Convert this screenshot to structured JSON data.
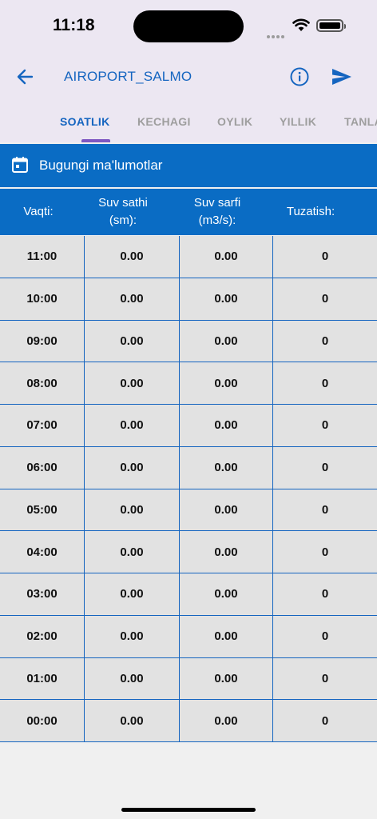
{
  "status": {
    "time": "11:18"
  },
  "header": {
    "title": "AIROPORT_SALMO"
  },
  "icons": {
    "back": "arrow-left-icon",
    "info": "info-icon",
    "send": "send-icon",
    "calendar": "calendar-icon"
  },
  "tabs": [
    {
      "label": "SOATLIK",
      "active": true
    },
    {
      "label": "KECHAGI",
      "active": false
    },
    {
      "label": "OYLIK",
      "active": false
    },
    {
      "label": "YILLIK",
      "active": false
    },
    {
      "label": "TANLA",
      "active": false
    }
  ],
  "section": {
    "title": "Bugungi ma'lumotlar"
  },
  "table": {
    "columns": [
      "Vaqti:",
      "Suv sathi\n(sm):",
      "Suv sarfi\n(m3/s):",
      "Tuzatish:"
    ],
    "rows": [
      [
        "11:00",
        "0.00",
        "0.00",
        "0"
      ],
      [
        "10:00",
        "0.00",
        "0.00",
        "0"
      ],
      [
        "09:00",
        "0.00",
        "0.00",
        "0"
      ],
      [
        "08:00",
        "0.00",
        "0.00",
        "0"
      ],
      [
        "07:00",
        "0.00",
        "0.00",
        "0"
      ],
      [
        "06:00",
        "0.00",
        "0.00",
        "0"
      ],
      [
        "05:00",
        "0.00",
        "0.00",
        "0"
      ],
      [
        "04:00",
        "0.00",
        "0.00",
        "0"
      ],
      [
        "03:00",
        "0.00",
        "0.00",
        "0"
      ],
      [
        "02:00",
        "0.00",
        "0.00",
        "0"
      ],
      [
        "01:00",
        "0.00",
        "0.00",
        "0"
      ],
      [
        "00:00",
        "0.00",
        "0.00",
        "0"
      ]
    ]
  },
  "colors": {
    "accent": "#1565c0",
    "header_bg": "#0a6cc4",
    "row_bg": "#e2e2e2",
    "indicator": "#7e57c2"
  }
}
